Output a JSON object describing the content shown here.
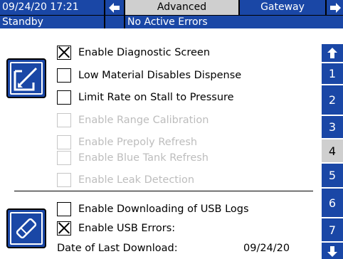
{
  "header": {
    "datetime": "09/24/20 17:21",
    "tabs": [
      "Advanced",
      "Gateway"
    ],
    "active_tab": "Advanced",
    "status": "Standby",
    "errors": "No Active Errors"
  },
  "options_top": [
    {
      "label": "Enable Diagnostic Screen",
      "checked": true,
      "enabled": true
    },
    {
      "label": "Low Material Disables Dispense",
      "checked": false,
      "enabled": true
    },
    {
      "label": "Limit Rate on Stall to Pressure",
      "checked": false,
      "enabled": true
    },
    {
      "label": "Enable Range Calibration",
      "checked": false,
      "enabled": false
    },
    {
      "label": "Enable Prepoly Refresh",
      "checked": false,
      "enabled": false
    },
    {
      "label": "Enable Blue Tank Refresh",
      "checked": false,
      "enabled": false
    },
    {
      "label": "Enable Leak Detection",
      "checked": false,
      "enabled": false
    }
  ],
  "options_bottom": [
    {
      "label": "Enable Downloading of USB Logs",
      "checked": false,
      "enabled": true
    },
    {
      "label": "Enable USB Errors:",
      "checked": true,
      "enabled": true
    }
  ],
  "last_download": {
    "label": "Date of Last Download:",
    "value": "09/24/20"
  },
  "pages": [
    "1",
    "2",
    "3",
    "4",
    "5",
    "6",
    "7"
  ],
  "active_page": "4",
  "icons": {
    "left": "arrow-left-icon",
    "right": "arrow-right-icon",
    "up": "arrow-up-icon",
    "down": "arrow-down-icon",
    "edit": "edit-pen-icon",
    "eraser": "eraser-icon"
  },
  "colors": {
    "accent": "#1a47a6",
    "tab_active": "#cfcfcf",
    "disabled_text": "#bdbdbd"
  }
}
